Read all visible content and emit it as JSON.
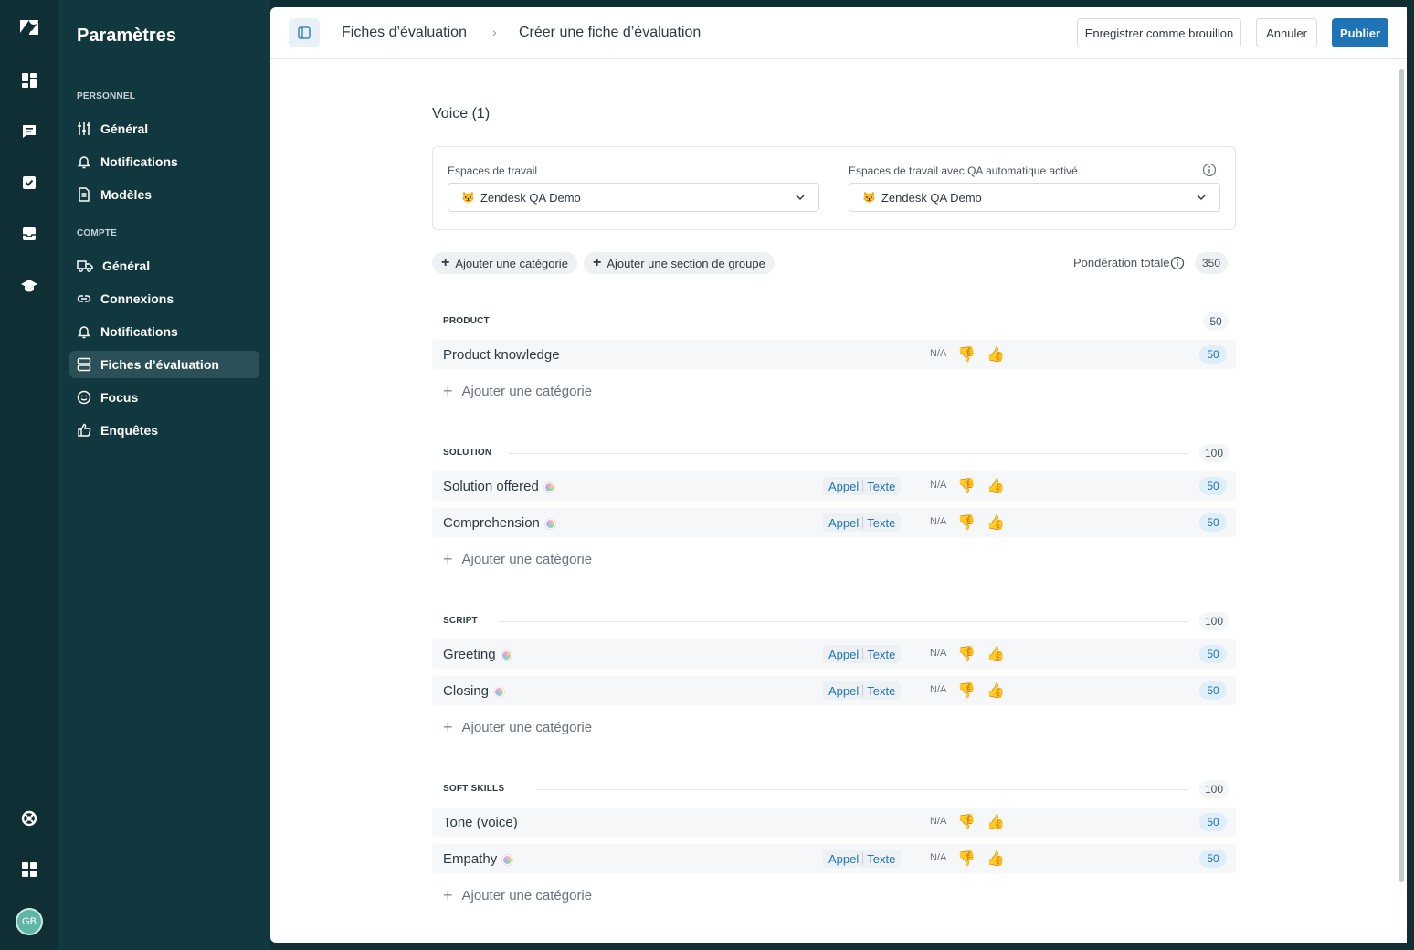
{
  "app": {
    "title": "Paramètres",
    "avatar_initials": "GB",
    "brand": "zendesk-logo"
  },
  "rail": {
    "icons": [
      "zendesk-logo-icon",
      "dashboard-icon",
      "conversations-icon",
      "assignments-icon",
      "inbox-icon",
      "education-icon",
      "help-icon",
      "apps-icon"
    ]
  },
  "sidebar": {
    "section_personal": "PERSONNEL",
    "personal_items": [
      {
        "label": "Général",
        "icon": "sliders-icon"
      },
      {
        "label": "Notifications",
        "icon": "bell-icon"
      },
      {
        "label": "Modèles",
        "icon": "document-icon"
      }
    ],
    "section_account": "COMPTE",
    "account_items": [
      {
        "label": "Général",
        "icon": "truck-icon"
      },
      {
        "label": "Connexions",
        "icon": "link-icon"
      },
      {
        "label": "Notifications",
        "icon": "bell-icon"
      },
      {
        "label": "Fiches d’évaluation",
        "icon": "scorecard-icon",
        "active": true
      },
      {
        "label": "Focus",
        "icon": "smiley-icon"
      },
      {
        "label": "Enquêtes",
        "icon": "thumbs-up-icon"
      }
    ]
  },
  "topbar": {
    "breadcrumb_parent": "Fiches d’évaluation",
    "breadcrumb_separator": "›",
    "breadcrumb_current": "Créer une fiche d’évaluation",
    "save_draft": "Enregistrer comme brouillon",
    "cancel": "Annuler",
    "publish": "Publier"
  },
  "scorecard": {
    "title": "Voice (1)",
    "workspaces_label": "Espaces de travail",
    "workspaces_value": "Zendesk QA Demo",
    "auto_qa_label": "Espaces de travail avec QA automatique activé",
    "auto_qa_value": "Zendesk QA Demo",
    "workspace_emoji": "😾",
    "add_category": "Ajouter une catégorie",
    "add_group_section": "Ajouter une section de groupe",
    "total_weight_label": "Pondération totale",
    "total_weight": "350",
    "na_label": "N/A",
    "tag_call": "Appel",
    "tag_text": "Texte",
    "thumb_down": "👎",
    "thumb_up": "👍",
    "add_category_row": "Ajouter une catégorie",
    "sections": [
      {
        "name": "PRODUCT",
        "weight": "50",
        "rows": [
          {
            "label": "Product knowledge",
            "weight": "50",
            "autoqa": false
          }
        ]
      },
      {
        "name": "SOLUTION",
        "weight": "100",
        "rows": [
          {
            "label": "Solution offered",
            "weight": "50",
            "autoqa": true
          },
          {
            "label": "Comprehension",
            "weight": "50",
            "autoqa": true
          }
        ]
      },
      {
        "name": "SCRIPT",
        "weight": "100",
        "rows": [
          {
            "label": "Greeting",
            "weight": "50",
            "autoqa": true
          },
          {
            "label": "Closing",
            "weight": "50",
            "autoqa": true
          }
        ]
      },
      {
        "name": "SOFT SKILLS",
        "weight": "100",
        "rows": [
          {
            "label": "Tone (voice)",
            "weight": "50",
            "autoqa": false
          },
          {
            "label": "Empathy",
            "weight": "50",
            "autoqa": true
          }
        ]
      }
    ]
  },
  "colors": {
    "rail": "#0f2f35",
    "sidebar": "#12383f",
    "active_item": "#2b5057",
    "primary": "#1f73b7",
    "tag_text": "#1f73b7",
    "weight_badge_bg": "#dfeffa"
  }
}
